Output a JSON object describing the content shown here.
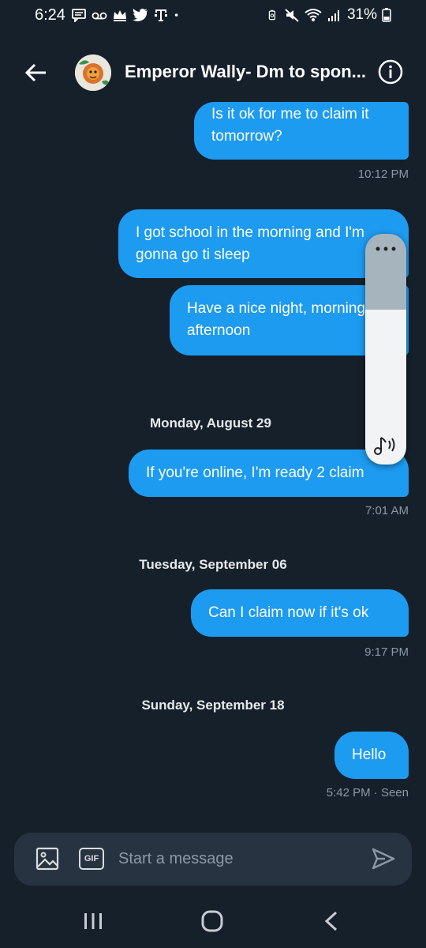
{
  "status_bar": {
    "time": "6:24",
    "battery_percent": "31%"
  },
  "header": {
    "contact_name": "Emperor Wally- Dm to spon..."
  },
  "messages": [
    {
      "text": "Is it ok for me to claim it tomorrow?"
    },
    {
      "timestamp": "10:12 PM"
    },
    {
      "text": "I got school in the morning and I'm gonna go ti sleep"
    },
    {
      "text": "Have a nice night, morning or afternoon"
    },
    {
      "date": "Monday, August 29"
    },
    {
      "text": "If you're online, I'm ready 2 claim"
    },
    {
      "timestamp": "7:01 AM"
    },
    {
      "date": "Tuesday, September 06"
    },
    {
      "text": "Can I claim now if it's ok"
    },
    {
      "timestamp": "9:17 PM"
    },
    {
      "date": "Sunday, September 18"
    },
    {
      "text": "Hello"
    },
    {
      "timestamp": "5:42 PM · Seen"
    }
  ],
  "composer": {
    "placeholder": "Start a message",
    "gif_label": "GIF"
  },
  "volume_overlay": {
    "level": 0.67
  },
  "colors": {
    "background": "#15202b",
    "bubble": "#1d9bf0",
    "composer": "#273340",
    "muted_text": "#8b98a5"
  },
  "icons": [
    "message-icon",
    "voicemail-icon",
    "crown-icon",
    "twitter-icon",
    "tmobile-icon",
    "dot-icon",
    "battery-saver-icon",
    "mute-icon",
    "wifi-icon",
    "signal-icon",
    "battery-icon",
    "back-arrow-icon",
    "info-icon",
    "image-icon",
    "gif-icon",
    "send-icon",
    "more-dots-icon",
    "music-volume-icon",
    "recents-icon",
    "home-icon",
    "nav-back-icon"
  ]
}
